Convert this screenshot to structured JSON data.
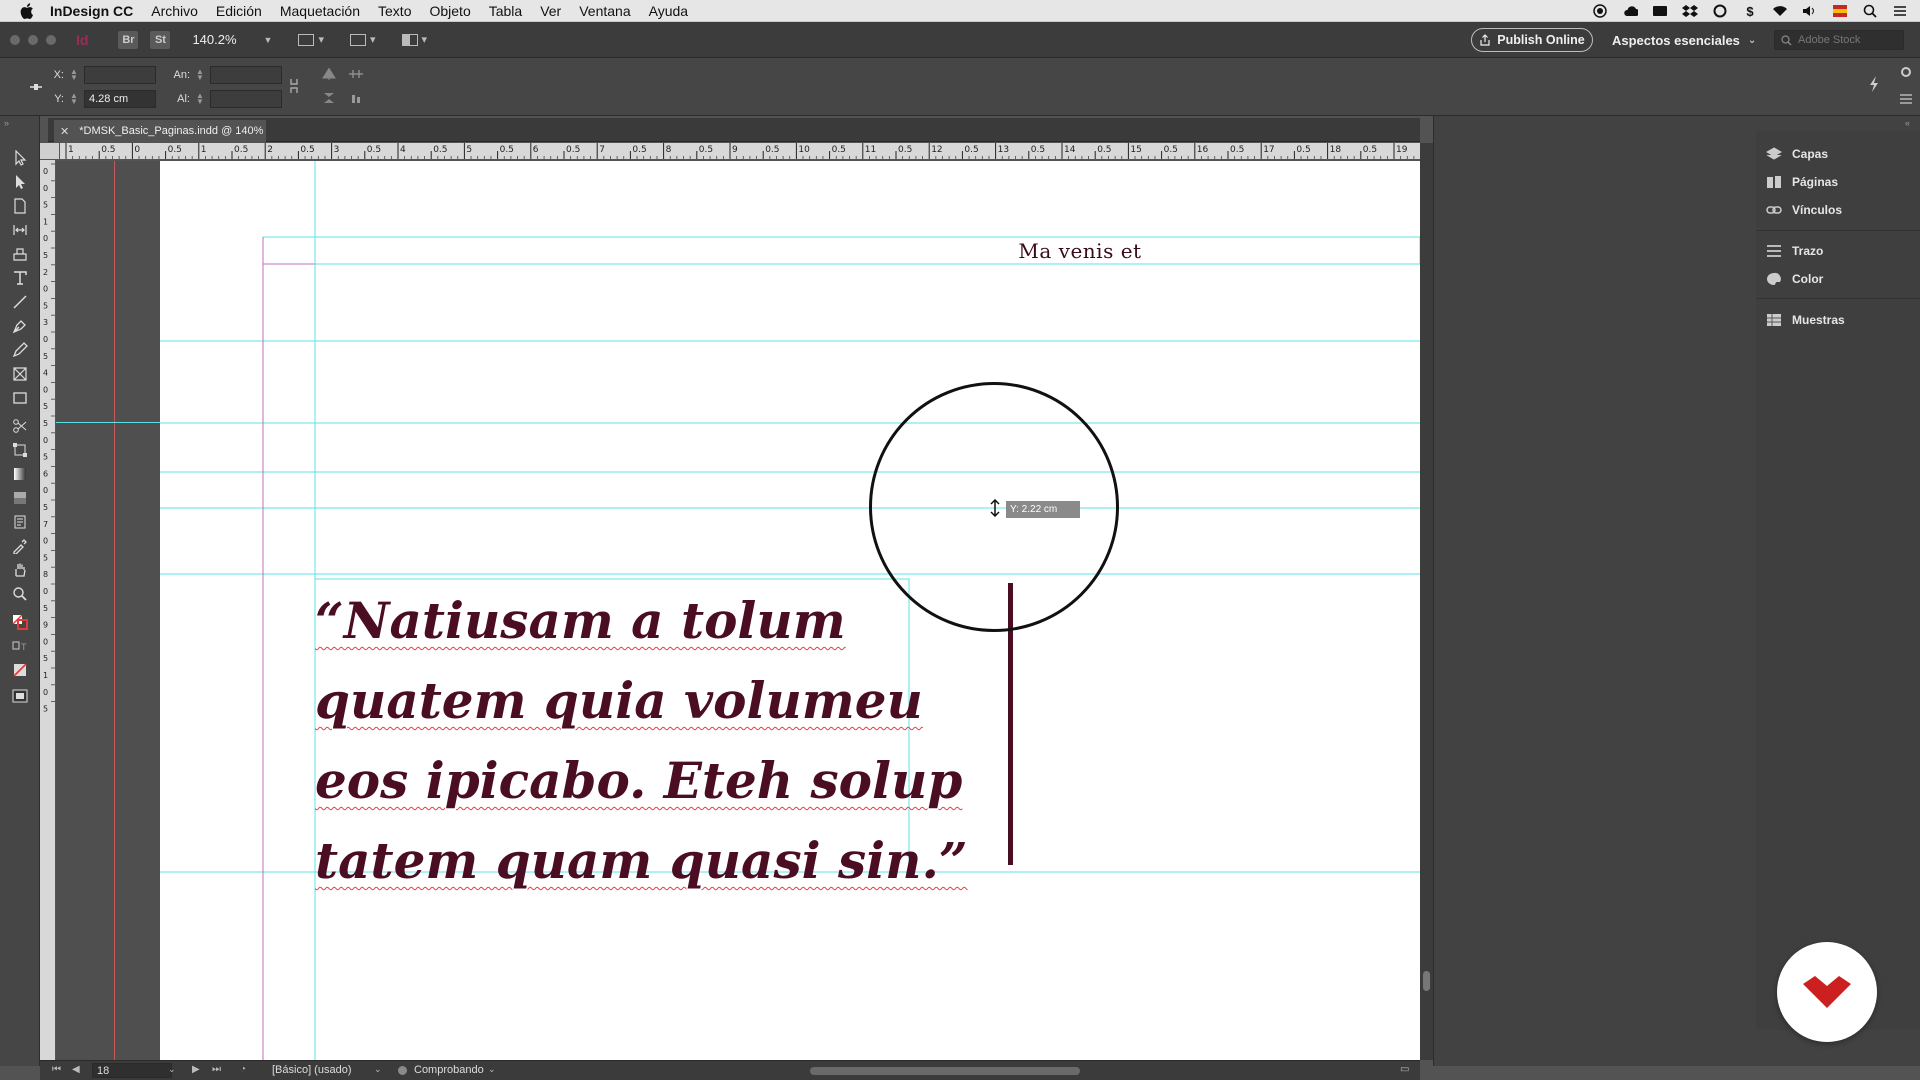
{
  "menubar": {
    "app_name": "InDesign CC",
    "items": [
      "Archivo",
      "Edición",
      "Maquetación",
      "Texto",
      "Objeto",
      "Tabla",
      "Ver",
      "Ventana",
      "Ayuda"
    ]
  },
  "appbar": {
    "bridge_label": "Br",
    "stock_label": "St",
    "zoom": "140.2%",
    "publish_label": "Publish Online",
    "workspace_label": "Aspectos esenciales",
    "stock_search_placeholder": "Adobe Stock"
  },
  "control": {
    "x_label": "X:",
    "x_value": "",
    "y_label": "Y:",
    "y_value": "4.28 cm",
    "w_label": "An:",
    "w_value": "",
    "h_label": "Al:",
    "h_value": ""
  },
  "document": {
    "tab_title": "*DMSK_Basic_Paginas.indd @ 140%",
    "header_text": "Ma venis et",
    "quote_lines": [
      "“Natiusam a tolum",
      "quatem quia volumeu",
      "eos ipicabo. Eteh solup",
      "tatem quam quasi sin.”"
    ],
    "tooltip": "Y: 2.22 cm",
    "text_color": "#4a0d21"
  },
  "ruler": {
    "h_labels": [
      "1",
      "0.5",
      "0",
      "0.5",
      "1",
      "0.5",
      "2",
      "0.5",
      "3",
      "0.5",
      "4",
      "0.5",
      "5",
      "0.5",
      "6",
      "0.5",
      "7",
      "0.5",
      "8",
      "0.5",
      "9",
      "0.5",
      "10",
      "0.5",
      "11",
      "0.5",
      "12",
      "0.5",
      "13",
      "0.5",
      "14",
      "0.5",
      "15",
      "0.5",
      "16",
      "0.5",
      "17",
      "0.5",
      "18",
      "0.5",
      "19"
    ],
    "v_labels": [
      "0",
      "0",
      "5",
      "1",
      "0",
      "5",
      "2",
      "0",
      "5",
      "3",
      "0",
      "5",
      "4",
      "0",
      "5",
      "5",
      "0",
      "5",
      "6",
      "0",
      "5",
      "7",
      "0",
      "5",
      "8",
      "0",
      "5",
      "9",
      "0",
      "5",
      "1",
      "0",
      "5"
    ]
  },
  "panels": {
    "items": [
      {
        "label": "Capas",
        "icon": "layers-icon"
      },
      {
        "label": "Páginas",
        "icon": "pages-icon"
      },
      {
        "label": "Vínculos",
        "icon": "links-icon"
      },
      {
        "label": "Trazo",
        "icon": "stroke-icon"
      },
      {
        "label": "Color",
        "icon": "color-icon"
      },
      {
        "label": "Muestras",
        "icon": "swatches-icon"
      }
    ]
  },
  "statusbar": {
    "page": "18",
    "style": "[Básico] (usado)",
    "preflight": "Comprobando"
  },
  "colors": {
    "guide": "#5ee0e8",
    "margin": "#c26fbe",
    "accent": "#d8246c",
    "logo": "#cc1f1f"
  }
}
